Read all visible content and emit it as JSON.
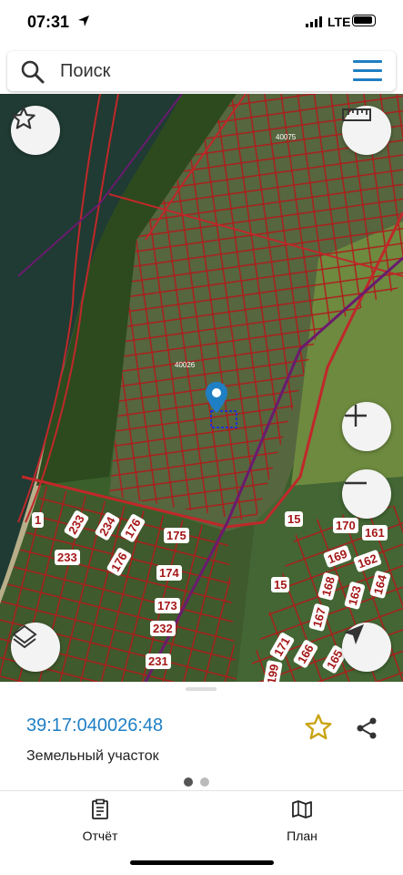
{
  "status_bar": {
    "time": "07:31",
    "network": "LTE"
  },
  "search": {
    "placeholder": "Поиск"
  },
  "map": {
    "quarter_labels": [
      "40075",
      "40026"
    ],
    "parcel_labels": [
      {
        "text": "1"
      },
      {
        "text": "233"
      },
      {
        "text": "234"
      },
      {
        "text": "176"
      },
      {
        "text": "175"
      },
      {
        "text": "233"
      },
      {
        "text": "176"
      },
      {
        "text": "174"
      },
      {
        "text": "173"
      },
      {
        "text": "232"
      },
      {
        "text": "231"
      },
      {
        "text": "15"
      },
      {
        "text": "170"
      },
      {
        "text": "161"
      },
      {
        "text": "169"
      },
      {
        "text": "162"
      },
      {
        "text": "15"
      },
      {
        "text": "168"
      },
      {
        "text": "163"
      },
      {
        "text": "164"
      },
      {
        "text": "167"
      },
      {
        "text": "171"
      },
      {
        "text": "166"
      },
      {
        "text": "165"
      },
      {
        "text": "199"
      }
    ]
  },
  "parcel": {
    "cadastral_number": "39:17:040026:48",
    "type": "Земельный участок"
  },
  "tabs": [
    {
      "label": "Отчёт",
      "icon": "report-icon"
    },
    {
      "label": "План",
      "icon": "map-plan-icon"
    }
  ],
  "colors": {
    "accent": "#1f7fc4",
    "parcel_border": "#b01a1a",
    "star": "#c9a415"
  }
}
